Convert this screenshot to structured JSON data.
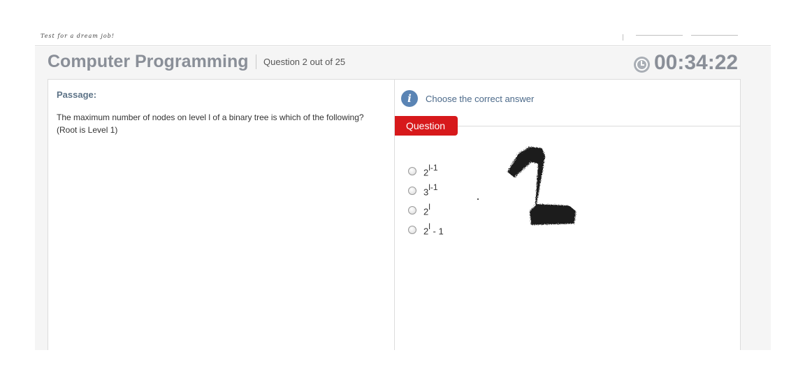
{
  "header": {
    "tagline": "Test for a dream job!"
  },
  "test": {
    "title": "Computer Programming",
    "question_counter": "Question 2 out of 25",
    "timer": "00:34:22"
  },
  "passage": {
    "label": "Passage:",
    "text": "The maximum number of nodes on level l of a binary tree is which of the following? (Root is Level 1)"
  },
  "question_panel": {
    "instruction": "Choose the correct answer",
    "tab_label": "Question",
    "options": [
      {
        "base": "2",
        "sup": "l-1",
        "tail": ""
      },
      {
        "base": "3",
        "sup": "l-1",
        "tail": ""
      },
      {
        "base": "2",
        "sup": "l",
        "tail": ""
      },
      {
        "base": "2",
        "sup": "l",
        "tail": " - 1"
      }
    ]
  },
  "colors": {
    "accent_red": "#d7191b",
    "info_blue": "#5a84b4",
    "title_gray": "#8a8f98"
  },
  "icons": [
    "clock-icon",
    "info-icon"
  ]
}
